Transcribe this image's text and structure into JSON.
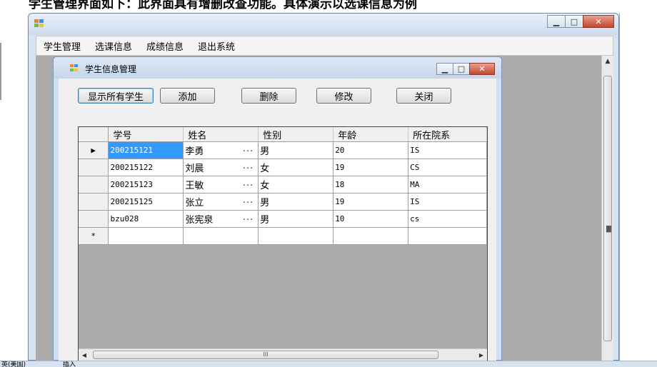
{
  "document": {
    "top_text": "学生管理界面如下：此界面具有增删改查功能。具体演示以选课信息为例"
  },
  "outer_window": {
    "menu": [
      {
        "label": "学生管理"
      },
      {
        "label": "选课信息"
      },
      {
        "label": "成绩信息"
      },
      {
        "label": "退出系统"
      }
    ]
  },
  "inner_window": {
    "title": "学生信息管理",
    "buttons": {
      "show_all": "显示所有学生",
      "add": "添加",
      "delete": "删除",
      "modify": "修改",
      "close": "关闭"
    }
  },
  "grid": {
    "columns": [
      "学号",
      "姓名",
      "性别",
      "年龄",
      "所在院系"
    ],
    "rows": [
      {
        "id": "200215121",
        "name": "李勇",
        "sex": "男",
        "age": "20",
        "dept": "IS"
      },
      {
        "id": "200215122",
        "name": "刘晨",
        "sex": "女",
        "age": "19",
        "dept": "CS"
      },
      {
        "id": "200215123",
        "name": "王敏",
        "sex": "女",
        "age": "18",
        "dept": "MA"
      },
      {
        "id": "200215125",
        "name": "张立",
        "sex": "男",
        "age": "19",
        "dept": "IS"
      },
      {
        "id": "bzu028",
        "name": "张宪泉",
        "sex": "男",
        "age": "10",
        "dept": "cs"
      }
    ],
    "ellipsis": "...",
    "current_row_marker": "▶",
    "new_row_marker": "*",
    "hscroll_grip": "III"
  },
  "status": {
    "left": "英(美国)",
    "insert": "插入"
  },
  "icons": {
    "minimize": "minimize-icon",
    "maximize": "maximize-icon",
    "close": "close-icon",
    "scroll_up": "scroll-up-icon",
    "scroll_left": "scroll-left-icon",
    "scroll_right": "scroll-right-icon"
  },
  "colors": {
    "selection": "#3399ff",
    "mdi_background": "#ababab",
    "title_bar": "#cfdcee"
  }
}
